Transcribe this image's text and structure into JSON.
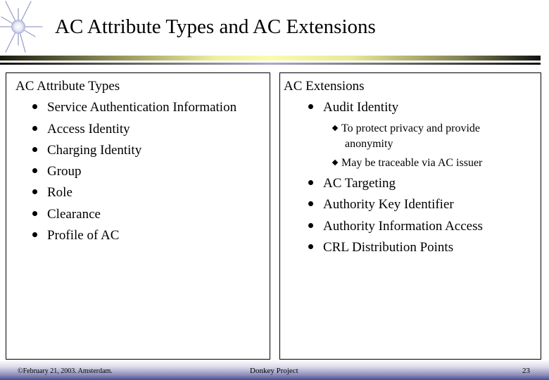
{
  "slide": {
    "title": "AC Attribute Types and AC Extensions",
    "logo_icon": "starburst-icon"
  },
  "left_box": {
    "heading": "AC Attribute Types",
    "items": [
      "Service Authentication Information",
      "Access Identity",
      "Charging Identity",
      "Group",
      "Role",
      "Clearance",
      "Profile of AC"
    ]
  },
  "right_box": {
    "heading": "AC Extensions",
    "items": [
      {
        "label": "Audit Identity",
        "sub_items": [
          {
            "line1": "To protect privacy and provide",
            "line2": "anonymity"
          },
          {
            "line1": "May be traceable via AC issuer"
          }
        ]
      },
      {
        "label": "AC Targeting"
      },
      {
        "label": "Authority Key Identifier"
      },
      {
        "label": "Authority Information Access"
      },
      {
        "label": "CRL Distribution Points"
      }
    ]
  },
  "footer": {
    "left": "©February 21, 2003. Amsterdam.",
    "center": "Donkey Project",
    "page_number": "23"
  }
}
